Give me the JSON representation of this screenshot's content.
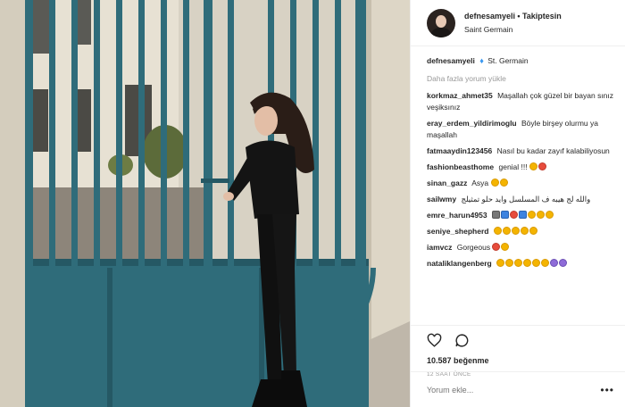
{
  "header": {
    "username": "defnesamyeli",
    "dot": "•",
    "follow_label": "Takiptesin",
    "location": "Saint Germain"
  },
  "caption": {
    "username": "defnesamyeli",
    "icon": "diamond-icon",
    "text": "St. Germain"
  },
  "load_more_label": "Daha fazla yorum yükle",
  "comments": [
    {
      "user": "korkmaz_ahmet35",
      "text": "Maşallah çok güzel bir bayan sınız veşiksınız",
      "emoji": []
    },
    {
      "user": "eray_erdem_yildirimoglu",
      "text": "Böyle birşey olurmu ya maşallah",
      "emoji": []
    },
    {
      "user": "fatmaaydin123456",
      "text": "Nasıl bu kadar zayıf kalabiliyosun",
      "emoji": []
    },
    {
      "user": "fashionbeasthome",
      "text": "genial !!!",
      "emoji": [
        "yellow",
        "red"
      ]
    },
    {
      "user": "sinan_gazz",
      "text": "Asya",
      "emoji": [
        "yellow",
        "yellow"
      ]
    },
    {
      "user": "sailwmy",
      "text": "والله لج هيبه ف المسلسل وايد حلو تمثيلج",
      "emoji": []
    },
    {
      "user": "emre_harun4953",
      "text": "",
      "emoji": [
        "grey",
        "blue",
        "red",
        "blue",
        "yellow",
        "yellow",
        "yellow"
      ]
    },
    {
      "user": "seniye_shepherd",
      "text": "",
      "emoji": [
        "yellow",
        "yellow",
        "yellow",
        "yellow",
        "yellow"
      ]
    },
    {
      "user": "iamvcz",
      "text": "Gorgeous",
      "emoji": [
        "red",
        "yellow"
      ]
    },
    {
      "user": "nataliklangenberg",
      "text": "",
      "emoji": [
        "yellow",
        "yellow",
        "yellow",
        "yellow",
        "yellow",
        "yellow",
        "purple",
        "purple"
      ]
    }
  ],
  "actions": {
    "like_icon": "heart-icon",
    "comment_icon": "comment-icon",
    "likes_text": "10.587 beğenme",
    "time_ago": "12 SAAT ÖNCE"
  },
  "add_comment": {
    "placeholder": "Yorum ekle...",
    "more_label": "•••"
  },
  "colors": {
    "gate": "#2f6c7a",
    "link": "#3897f0",
    "muted": "#999999",
    "text": "#262626"
  }
}
